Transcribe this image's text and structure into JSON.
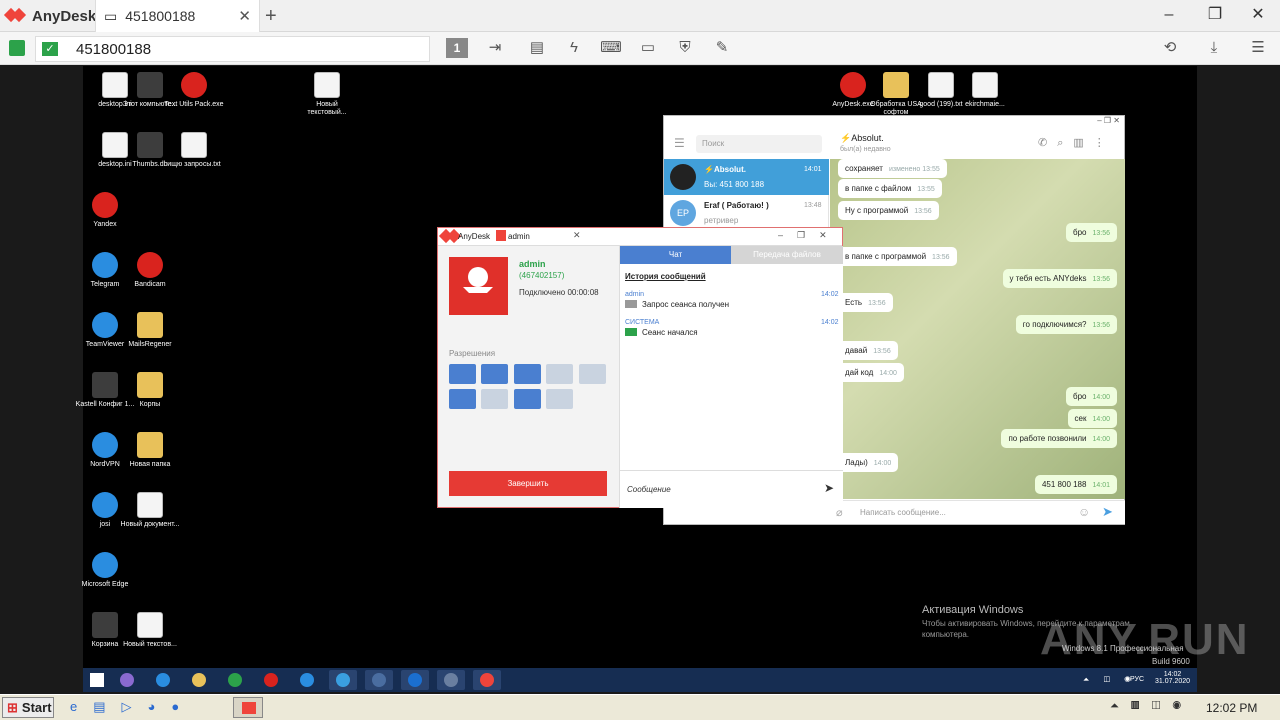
{
  "app": {
    "name": "AnyDesk",
    "tab_title": "451800188",
    "address": "451800188"
  },
  "remote_desktop": {
    "icons_left": [
      {
        "label": "desktop.ini",
        "type": "file"
      },
      {
        "label": "Этот компьюте...",
        "type": "dark"
      },
      {
        "label": "Text Utils Pack.exe",
        "type": "red"
      },
      {
        "label": "Новый текстовый...",
        "type": "file"
      },
      {
        "label": "desktop.ini",
        "type": "file"
      },
      {
        "label": "Thumbs.db",
        "type": "dark"
      },
      {
        "label": "ищю запросы.txt",
        "type": "file"
      },
      {
        "label": "Yandex",
        "type": "red"
      },
      {
        "label": "Telegram",
        "type": "blue"
      },
      {
        "label": "Bandicam",
        "type": "red"
      },
      {
        "label": "TeamViewer",
        "type": "blue"
      },
      {
        "label": "MailsRegener",
        "type": "folder"
      },
      {
        "label": "Kastell Конфиг 1...",
        "type": "dark"
      },
      {
        "label": "Корпы",
        "type": "folder"
      },
      {
        "label": "NordVPN",
        "type": "blue"
      },
      {
        "label": "Новая папка",
        "type": "folder"
      },
      {
        "label": "josi",
        "type": "blue"
      },
      {
        "label": "Новый документ...",
        "type": "file"
      },
      {
        "label": "Microsoft Edge",
        "type": "blue"
      },
      {
        "label": "Корзина",
        "type": "dark"
      },
      {
        "label": "Новый текстов...",
        "type": "file"
      }
    ],
    "icons_top_right": [
      {
        "label": "AnyDesk.exe",
        "type": "red"
      },
      {
        "label": "Обработка USA софтом",
        "type": "folder"
      },
      {
        "label": "good (199).txt",
        "type": "file"
      },
      {
        "label": "ekirchmaie...",
        "type": "file"
      }
    ],
    "activation": {
      "title": "Активация Windows",
      "text": "Чтобы активировать Windows, перейдите к параметрам компьютера.",
      "edition": "Windows 8.1 Профессиональная",
      "build": "Build 9600"
    },
    "watermark": "ANY.RUN",
    "clock": {
      "time": "14:02",
      "date": "31.07.2020",
      "lang": "РУС"
    }
  },
  "telegram": {
    "search_placeholder": "Поиск",
    "chats": [
      {
        "name": "⚡Absolut.",
        "preview": "Вы: 451 800 188",
        "time": "14:01",
        "active": true
      },
      {
        "name": "Eraf ( Работаю! )",
        "preview": "ретривер",
        "time": "13:48",
        "initials": "EP",
        "active": false
      }
    ],
    "header": {
      "name": "⚡Absolut.",
      "status": "был(а) недавно"
    },
    "messages": [
      {
        "text": "сохраняет",
        "time": "изменено 13:55",
        "me": false
      },
      {
        "text": "в папке с файлом",
        "time": "13:55",
        "me": false
      },
      {
        "text": "Ну с программой",
        "time": "13:56",
        "me": false
      },
      {
        "text": "бро",
        "time": "13:56",
        "me": true
      },
      {
        "text": "в папке с программой",
        "time": "13:56",
        "me": false
      },
      {
        "text": "у тебя есть ANYdeks",
        "time": "13:56",
        "me": true
      },
      {
        "text": "Есть",
        "time": "13:56",
        "me": false
      },
      {
        "text": "го подключимся?",
        "time": "13:56",
        "me": true
      },
      {
        "text": "давай",
        "time": "13:56",
        "me": false
      },
      {
        "text": "дай код",
        "time": "14:00",
        "me": false
      },
      {
        "text": "бро",
        "time": "14:00",
        "me": true
      },
      {
        "text": "сек",
        "time": "14:00",
        "me": true
      },
      {
        "text": "по работе позвонили",
        "time": "14:00",
        "me": true
      },
      {
        "text": "Лады)",
        "time": "14:00",
        "me": false
      },
      {
        "text": "451 800 188",
        "time": "14:01",
        "me": true
      }
    ],
    "compose_placeholder": "Написать сообщение..."
  },
  "anydesk_panel": {
    "title": "AnyDesk",
    "tab": "admin",
    "user": "admin",
    "user_id": "(467402157)",
    "status": "Подключено 00:00:08",
    "permissions_label": "Разрешения",
    "end_button": "Завершить",
    "tabs": [
      "Чат",
      "Передача файлов"
    ],
    "history_title": "История сообщений",
    "log": [
      {
        "sender": "admin",
        "time": "14:02",
        "text": "Запрос сеанса получен"
      },
      {
        "sender": "СИСТЕМА",
        "time": "14:02",
        "text": "Сеанс начался"
      }
    ],
    "message_placeholder": "Сообщение"
  },
  "host_taskbar": {
    "start": "Start",
    "clock": "12:02 PM"
  },
  "colors": {
    "anydesk_red": "#ef443b",
    "telegram_blue": "#4a9fe0",
    "win_taskbar": "#162d52"
  }
}
